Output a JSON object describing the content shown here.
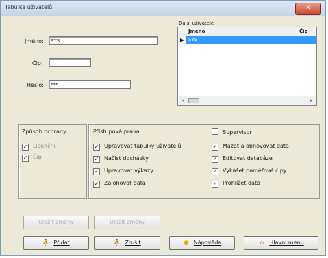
{
  "window": {
    "title": "Tabulka uživatelů",
    "close_label": "✕"
  },
  "form": {
    "jmeno_label": "Jméno:",
    "jmeno_value": "SYS",
    "cip_label": "Čip:",
    "cip_value": "",
    "heslo_label": "Heslo:",
    "heslo_value": "***"
  },
  "users_grid": {
    "caption": "Další uživatelé",
    "col_name": "Jméno",
    "col_cip": "Čip",
    "rows": [
      {
        "name": "SYS",
        "cip": ""
      }
    ],
    "row_pointer": "▶"
  },
  "protection": {
    "title": "Způsob ochrany",
    "items": [
      {
        "label": "Licenční i",
        "checked": true
      },
      {
        "label": "Čip",
        "checked": true
      }
    ]
  },
  "rights": {
    "title": "Přístupová práva",
    "supervisor": "Supervisor",
    "left": [
      "Upravovat tabulky uživatelů",
      "Načíst docházky",
      "Upravovat výkazy",
      "Zálohovat data"
    ],
    "right": [
      "Mazat a obnovovat data",
      "Editovat databáze",
      "Vykášet paměťové čipy",
      "Prohlížet data"
    ]
  },
  "buttons": {
    "disabled_1": "Uložit změny",
    "disabled_2": "Uložit změny",
    "pridat": "Přidat",
    "zrusit": "Zrušit",
    "napoveda": "Nápověda",
    "hlavni_menu": "Hlavní menu"
  },
  "colors": {
    "selection": "#3399ff",
    "dialog_bg": "#ece9d8"
  },
  "icons": {
    "pridat": "user-add-icon",
    "zrusit": "user-remove-icon",
    "napoveda": "lightbulb-icon",
    "hlavni_menu": "home-icon"
  }
}
